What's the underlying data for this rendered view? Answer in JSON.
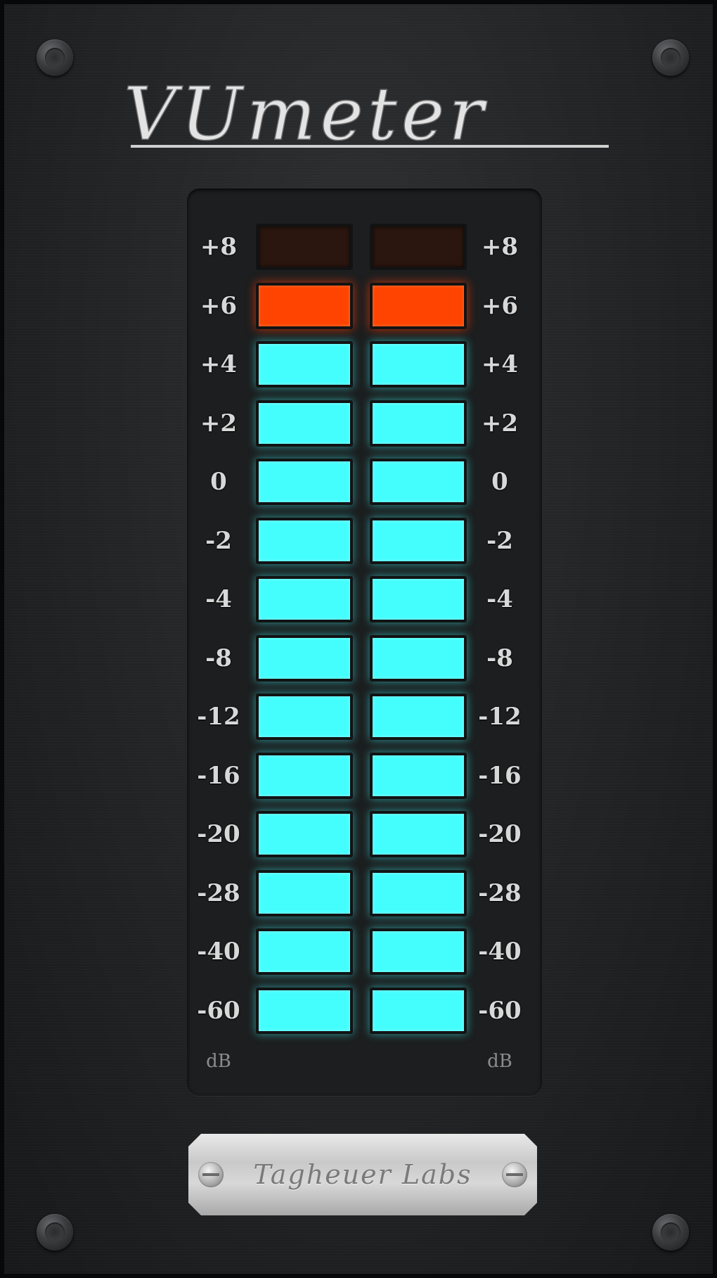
{
  "app": {
    "title": "VUmeter",
    "nameplate": "Tagheuer Labs"
  },
  "meter": {
    "scale": [
      "+8",
      "+6",
      "+4",
      "+2",
      "0",
      "-2",
      "-4",
      "-8",
      "-12",
      "-16",
      "-20",
      "-28",
      "-40",
      "-60"
    ],
    "unit": "dB",
    "channels": [
      {
        "states": [
          "off",
          "red",
          "cyan",
          "cyan",
          "cyan",
          "cyan",
          "cyan",
          "cyan",
          "cyan",
          "cyan",
          "cyan",
          "cyan",
          "cyan",
          "cyan"
        ]
      },
      {
        "states": [
          "off",
          "red",
          "cyan",
          "cyan",
          "cyan",
          "cyan",
          "cyan",
          "cyan",
          "cyan",
          "cyan",
          "cyan",
          "cyan",
          "cyan",
          "cyan"
        ]
      }
    ]
  },
  "colors": {
    "segment_on_cyan": "#44fefe",
    "segment_on_red": "#fe4400",
    "segment_off": "#2a160f",
    "panel_background": "#1c1e1f"
  }
}
